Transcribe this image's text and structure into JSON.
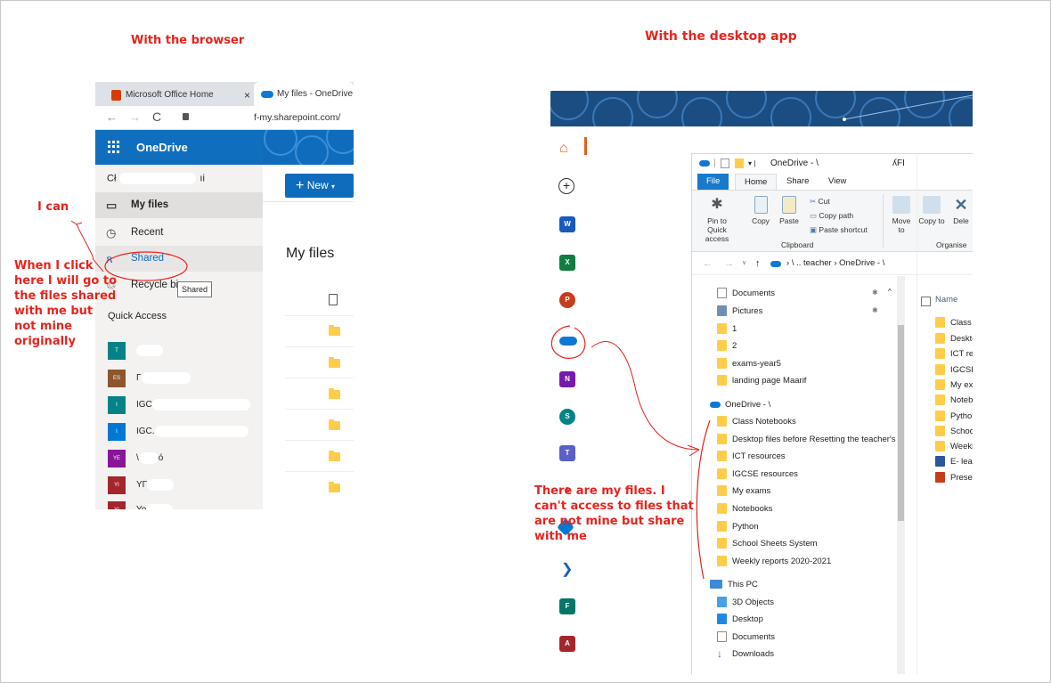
{
  "page": {
    "headings": {
      "browser": "With the browser",
      "desktop": "With the desktop app"
    },
    "annotations": {
      "i_can": "I can",
      "shared_note": [
        "When I click",
        "here I will go to",
        "the files shared",
        "with me but",
        "not mine",
        "originally"
      ],
      "desktop_note": [
        "There are my files. I",
        "can't access to files that",
        "are not mine but share",
        "with me"
      ]
    }
  },
  "browser": {
    "tabs": [
      {
        "label": "Microsoft Office Home",
        "close": "×"
      },
      {
        "label": "My files - OneDrive"
      }
    ],
    "address": {
      "url_visible": "f-my.sharepoint.com/"
    },
    "header": {
      "app_name": "OneDrive",
      "new_button": "New"
    },
    "sidebar": {
      "user_partial": "Cł",
      "user_tail": "ıi",
      "items": [
        {
          "label": "My files",
          "icon": "folder-outline-icon"
        },
        {
          "label": "Recent",
          "icon": "clock-icon"
        },
        {
          "label": "Shared",
          "icon": "people-icon"
        },
        {
          "label": "Recycle bi",
          "icon": "recycle-bin-icon"
        }
      ],
      "tooltip": "Shared",
      "quick_access_title": "Quick Access",
      "quick_access": [
        {
          "badge": "T",
          "color": "#038387",
          "label": ""
        },
        {
          "badge": "ES",
          "color": "#8e562e",
          "label": "Γ"
        },
        {
          "badge": "I",
          "color": "#038387",
          "label": "IGC"
        },
        {
          "badge": "I",
          "color": "#0078d4",
          "label": "IGC."
        },
        {
          "badge": "YE",
          "color": "#881798",
          "label": "\\",
          "label_tail": "ó"
        },
        {
          "badge": "YI",
          "color": "#a4262c",
          "label": "YΓ"
        },
        {
          "badge": "YI",
          "color": "#a4262c",
          "label": "Yo"
        }
      ]
    },
    "main": {
      "title": "My files",
      "rows": 6
    }
  },
  "explorer": {
    "title": "OneDrive - \\",
    "title_tail": "ʎFI",
    "ribbon_tabs": [
      "File",
      "Home",
      "Share",
      "View"
    ],
    "ribbon": {
      "pin": "Pin to Quick access",
      "copy": "Copy",
      "paste": "Paste",
      "cut": "Cut",
      "copy_path": "Copy path",
      "paste_shortcut": "Paste shortcut",
      "clipboard_group": "Clipboard",
      "move_to": "Move to",
      "copy_to": "Copy to",
      "delete": "Dele",
      "organise_group": "Organise"
    },
    "path": [
      "\\ .. teacher",
      "OneDrive - \\"
    ],
    "tree_top": [
      "Documents",
      "Pictures",
      "1",
      "2",
      "exams-year5",
      "landing page Maarif"
    ],
    "onedrive_label": "OneDrive - \\",
    "onedrive_folders": [
      "Class Notebooks",
      "Desktop files before Resetting the teacher's",
      "ICT resources",
      "IGCSE resources",
      "My exams",
      "Notebooks",
      "Python",
      "School Sheets System",
      "Weekly reports 2020-2021"
    ],
    "this_pc": "This PC",
    "pc_items": [
      "3D Objects",
      "Desktop",
      "Documents",
      "Downloads"
    ],
    "name_header": "Name",
    "file_list": [
      "Class I",
      "Deskto",
      "ICT res",
      "IGCSE",
      "My ex",
      "Noteb",
      "Pytho",
      "Schoo",
      "Weekl",
      "E- lear",
      "Preser"
    ]
  }
}
